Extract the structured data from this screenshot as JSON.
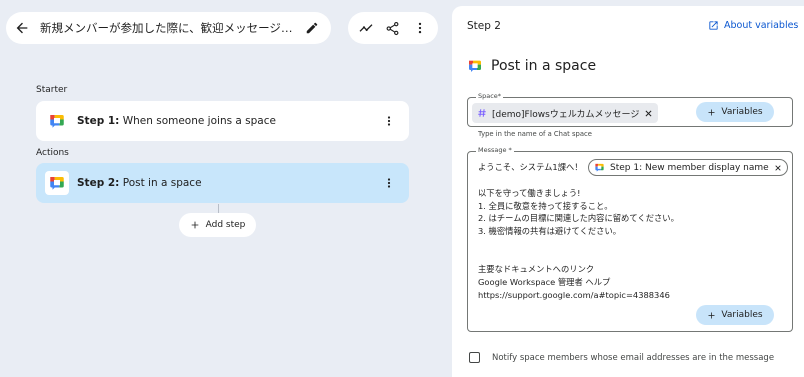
{
  "toolbar": {
    "flow_title": "新規メンバーが参加した際に、歓迎メッセージとチーム...",
    "icons": [
      "arrow-back-icon",
      "edit-pencil-icon",
      "activity-icon",
      "share-icon",
      "more-vert-icon"
    ]
  },
  "canvas": {
    "starter_label": "Starter",
    "actions_label": "Actions",
    "steps": [
      {
        "prefix": "Step 1:",
        "label": "When someone joins a space"
      },
      {
        "prefix": "Step 2:",
        "label": "Post in a space"
      }
    ],
    "add_step_label": "Add step"
  },
  "panel": {
    "step_label": "Step 2",
    "about_variables": "About variables",
    "title": "Post in a space",
    "space_field": {
      "label": "Space*",
      "chip": "[demo]Flowsウェルカムメッセージ",
      "variables_button": "Variables",
      "hint": "Type in the name of a Chat space"
    },
    "message_field": {
      "label": "Message *",
      "greeting": "ようこそ、システム1課へ！",
      "variable_chip": "Step 1: New member display name",
      "lines": [
        "以下を守って働きましょう!",
        "1. 全員に敬意を持って接すること。",
        "2. はチームの目標に関連した内容に留めてください。",
        "3. 機密情報の共有は避けてください。"
      ],
      "doc_lines": [
        "主要なドキュメントへのリンク",
        "Google Workspace 管理者 ヘルプ",
        "https://support.google.com/a#topic=4388346"
      ],
      "variables_button": "Variables"
    },
    "notify_label": "Notify space members whose email addresses are in the message",
    "accent_color": "#0b57d0",
    "selected_color": "#c8e6fb"
  }
}
